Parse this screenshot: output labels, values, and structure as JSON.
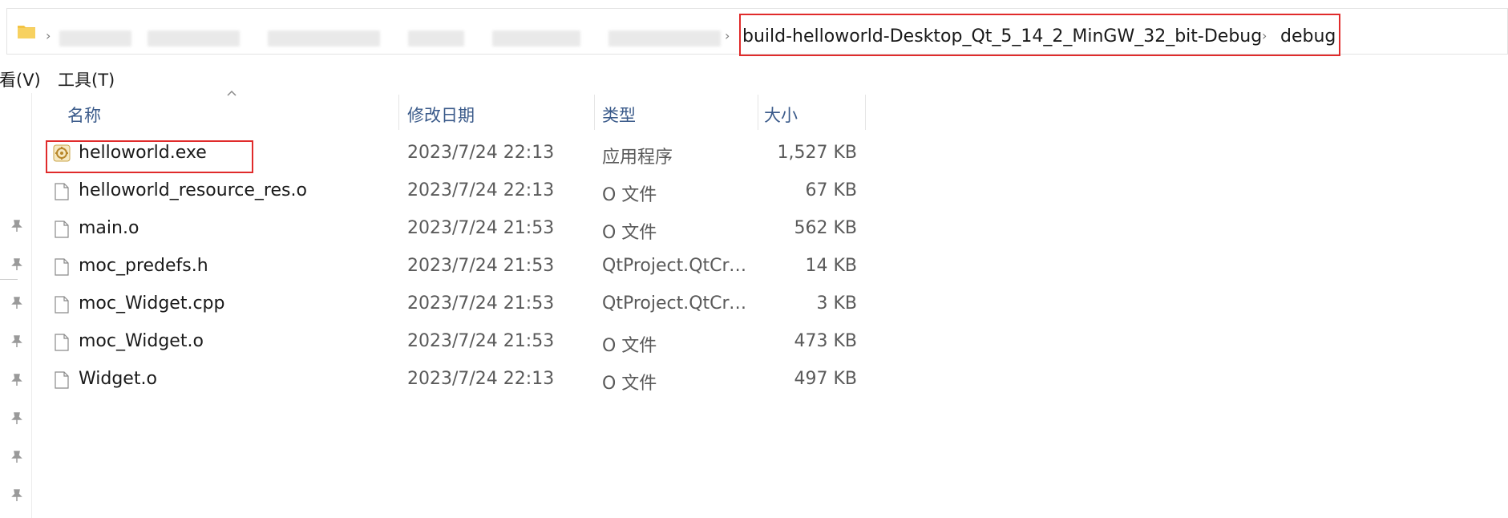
{
  "address": {
    "path_segments": [
      "build-helloworld-Desktop_Qt_5_14_2_MinGW_32_bit-Debug",
      "debug"
    ],
    "separator": "›"
  },
  "menu": {
    "view": "查看(V)",
    "tools": "工具(T)"
  },
  "columns": {
    "name": "名称",
    "modified": "修改日期",
    "type": "类型",
    "size": "大小"
  },
  "files": [
    {
      "name": "helloworld.exe",
      "modified": "2023/7/24 22:13",
      "type": "应用程序",
      "size": "1,527 KB",
      "icon": "qt-app-icon"
    },
    {
      "name": "helloworld_resource_res.o",
      "modified": "2023/7/24 22:13",
      "type": "O 文件",
      "size": "67 KB",
      "icon": "file-icon"
    },
    {
      "name": "main.o",
      "modified": "2023/7/24 21:53",
      "type": "O 文件",
      "size": "562 KB",
      "icon": "file-icon"
    },
    {
      "name": "moc_predefs.h",
      "modified": "2023/7/24 21:53",
      "type": "QtProject.QtCre...",
      "size": "14 KB",
      "icon": "file-icon"
    },
    {
      "name": "moc_Widget.cpp",
      "modified": "2023/7/24 21:53",
      "type": "QtProject.QtCre...",
      "size": "3 KB",
      "icon": "file-icon"
    },
    {
      "name": "moc_Widget.o",
      "modified": "2023/7/24 21:53",
      "type": "O 文件",
      "size": "473 KB",
      "icon": "file-icon"
    },
    {
      "name": "Widget.o",
      "modified": "2023/7/24 22:13",
      "type": "O 文件",
      "size": "497 KB",
      "icon": "file-icon"
    }
  ],
  "colors": {
    "highlight": "#e02b2b",
    "header_text": "#3a5a8a",
    "folder": "#f3c343"
  }
}
